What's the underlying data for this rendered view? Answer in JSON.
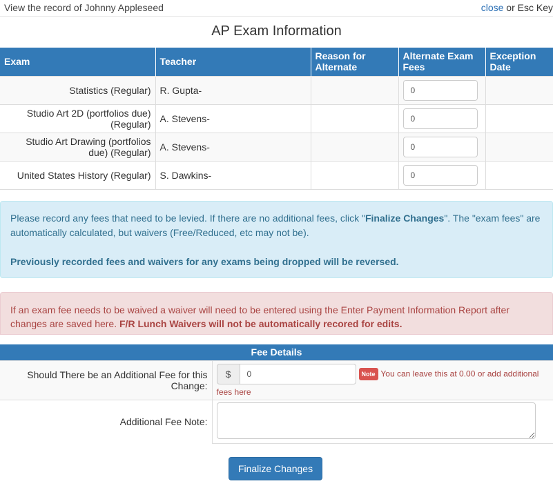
{
  "header": {
    "record_text": "View the record of Johnny Appleseed",
    "close_label": "close",
    "close_suffix": " or Esc Key"
  },
  "page_title": "AP Exam Information",
  "exam_table": {
    "headers": [
      "Exam",
      "Teacher",
      "Reason for Alternate",
      "Alternate Exam Fees",
      "Exception Date"
    ],
    "rows": [
      {
        "exam": "Statistics (Regular)",
        "teacher": "R. Gupta-",
        "reason": "",
        "fee": "0",
        "exception_date": ""
      },
      {
        "exam": "Studio Art 2D (portfolios due) (Regular)",
        "teacher": "A. Stevens-",
        "reason": "",
        "fee": "0",
        "exception_date": ""
      },
      {
        "exam": "Studio Art Drawing (portfolios due) (Regular)",
        "teacher": "A. Stevens-",
        "reason": "",
        "fee": "0",
        "exception_date": ""
      },
      {
        "exam": "United States History (Regular)",
        "teacher": "S. Dawkins-",
        "reason": "",
        "fee": "0",
        "exception_date": ""
      }
    ]
  },
  "info_alert": {
    "text_before": "Please record any fees that need to be levied. If there are no additional fees, click \"",
    "finalize_ref": "Finalize Changes",
    "text_after": "\". The \"exam fees\" are automatically calculated, but waivers (Free/Reduced, etc may not be).",
    "bold_line": "Previously recorded fees and waivers for any exams being dropped will be reversed."
  },
  "danger_alert": {
    "text": "If an exam fee needs to be waived a waiver will need to be entered using the Enter Payment Information Report after changes are saved here. ",
    "bold_text": "F/R Lunch Waivers will not be automatically recored for edits."
  },
  "fee_details": {
    "heading": "Fee Details",
    "additional_fee_label": "Should There be an Additional Fee for this Change:",
    "currency_symbol": "$",
    "additional_fee_value": "0",
    "note_badge": "Note",
    "note_text": "You can leave this at 0.00 or add additional fees here",
    "note_label": "Additional Fee Note:",
    "note_value": ""
  },
  "finalize_button": "Finalize Changes",
  "colors": {
    "primary": "#337ab7",
    "info_bg": "#d9edf7",
    "danger_bg": "#f2dede",
    "note_badge": "#d9534f"
  }
}
